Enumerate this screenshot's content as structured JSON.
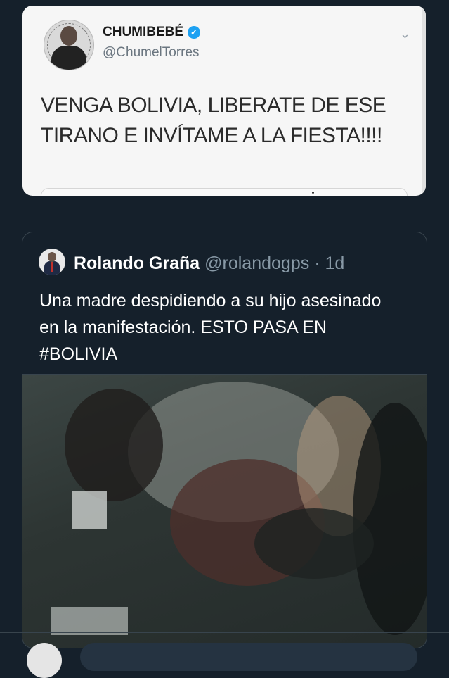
{
  "screenshot_tweet": {
    "display_name": "CHUMIBEBÉ",
    "handle": "@ChumelTorres",
    "text": "VENGA BOLIVIA, LIBERATE DE ESE TIRANO E INVÍTAME A LA FIESTA!!!!",
    "avatar_text": "EL PULSO DE LA REPÚBLICA",
    "verified_icon": "verified-badge-icon",
    "menu_icon": "chevron-down-icon"
  },
  "quoted_tweet": {
    "display_name": "Rolando Graña",
    "handle": "@rolandogps",
    "separator": "·",
    "time": "1d",
    "text": "Una madre despidiendo a su hijo asesinado en la manifestación. ESTO PASA EN #BOLIVIA",
    "media_icon": "video-thumbnail"
  },
  "colors": {
    "background": "#15202b",
    "border": "#38444d",
    "secondary_text": "#8899a6",
    "verified": "#1da1f2"
  }
}
